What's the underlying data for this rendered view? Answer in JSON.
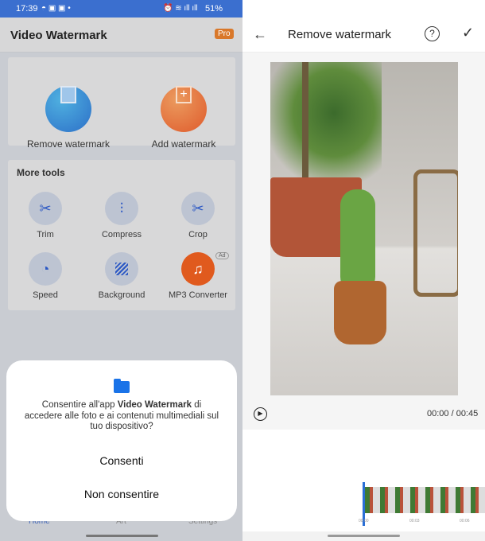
{
  "status_bar": {
    "time": "17:39",
    "battery": "51%"
  },
  "left": {
    "app_title": "Video Watermark",
    "pro_badge": "Pro",
    "main_actions": [
      {
        "label": "Remove watermark",
        "icon": "film-eraser-icon"
      },
      {
        "label": "Add watermark",
        "icon": "film-plus-icon"
      }
    ],
    "more_tools_title": "More tools",
    "tools": [
      {
        "label": "Trim",
        "icon": "scissors-icon"
      },
      {
        "label": "Compress",
        "icon": "zipper-icon"
      },
      {
        "label": "Crop",
        "icon": "scissors-icon"
      },
      {
        "label": "Speed",
        "icon": "speedometer-icon"
      },
      {
        "label": "Background",
        "icon": "hatch-icon"
      },
      {
        "label": "MP3 Converter",
        "icon": "music-film-icon",
        "badge": "Ad"
      }
    ],
    "bottom_nav": [
      {
        "label": "Home",
        "active": true
      },
      {
        "label": "Art"
      },
      {
        "label": "Settings"
      }
    ],
    "dialog": {
      "text_before": "Consentire all'app ",
      "app_name": "Video Watermark",
      "text_after": " di accedere alle foto e ai contenuti multimediali sul tuo dispositivo?",
      "allow": "Consenti",
      "deny": "Non consentire",
      "icon": "folder-icon"
    }
  },
  "right": {
    "title": "Remove watermark",
    "time_readout": "00:00 / 00:45",
    "timeline_labels": [
      "00:00",
      "00:03",
      "00:06"
    ]
  },
  "colors": {
    "accent": "#2a6fd6",
    "status_bar": "#3b6fcf",
    "remove_btn": "#2f86d6",
    "add_btn": "#e3652f",
    "folder": "#1a73e8"
  }
}
